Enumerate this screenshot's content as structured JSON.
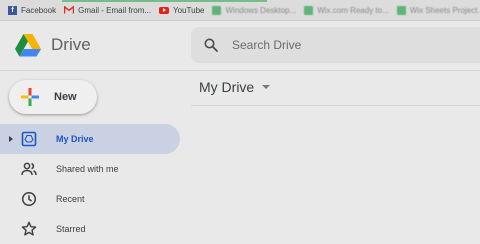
{
  "bookmarks": {
    "facebook": "Facebook",
    "gmail": "Gmail - Email from...",
    "youtube": "YouTube",
    "blurred": [
      "Windows Desktop...",
      "Wix.com Ready to...",
      "Wix Sheets Project..."
    ]
  },
  "app": {
    "title": "Drive"
  },
  "search": {
    "placeholder": "Search Drive"
  },
  "new_button": {
    "label": "New"
  },
  "sidebar": {
    "items": [
      {
        "label": "My Drive",
        "icon": "my-drive-icon",
        "active": true
      },
      {
        "label": "Shared with me",
        "icon": "shared-people-icon"
      },
      {
        "label": "Recent",
        "icon": "clock-icon"
      },
      {
        "label": "Starred",
        "icon": "star-icon"
      }
    ]
  },
  "main": {
    "title": "My Drive"
  },
  "colors": {
    "accent": "#1a56c9",
    "active_bg": "#c9d1e2",
    "page_bg": "#e9e9e9"
  }
}
